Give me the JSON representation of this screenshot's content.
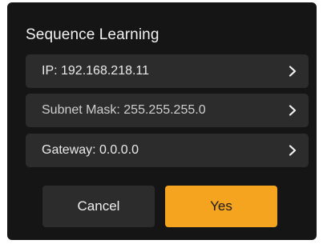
{
  "dialog": {
    "title": "Sequence Learning",
    "rows": [
      {
        "label": "IP:  192.168.218.11",
        "icon": "chevron-right-icon"
      },
      {
        "label": "Subnet Mask: 255.255.255.0",
        "icon": "chevron-right-icon"
      },
      {
        "label": "Gateway:  0.0.0.0",
        "icon": "chevron-right-icon"
      }
    ],
    "cancel_label": "Cancel",
    "yes_label": "Yes"
  },
  "colors": {
    "dialog_background": "#151515",
    "row_background": "#2c2c2c",
    "accent": "#f5a41f",
    "text": "#f2f2f2"
  }
}
